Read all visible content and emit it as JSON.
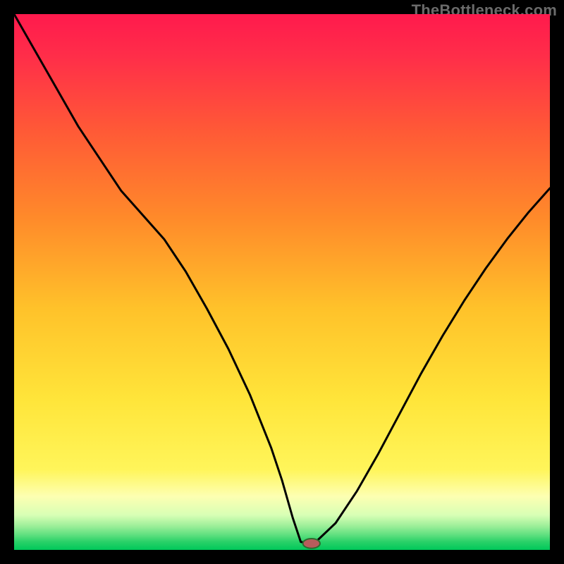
{
  "watermark": "TheBottleneck.com",
  "colors": {
    "black": "#000000",
    "curve": "#000000",
    "marker_fill": "#b85c5c",
    "marker_stroke": "#2f6a2f",
    "gradient_stops": [
      {
        "offset": 0.0,
        "color": "#ff1a4d"
      },
      {
        "offset": 0.08,
        "color": "#ff2e49"
      },
      {
        "offset": 0.22,
        "color": "#ff5a36"
      },
      {
        "offset": 0.38,
        "color": "#ff8a2a"
      },
      {
        "offset": 0.55,
        "color": "#ffc22a"
      },
      {
        "offset": 0.72,
        "color": "#ffe53a"
      },
      {
        "offset": 0.85,
        "color": "#fff55a"
      },
      {
        "offset": 0.9,
        "color": "#fdffb2"
      },
      {
        "offset": 0.935,
        "color": "#d8ffb5"
      },
      {
        "offset": 0.955,
        "color": "#9eef9a"
      },
      {
        "offset": 0.972,
        "color": "#5fe07f"
      },
      {
        "offset": 0.985,
        "color": "#29d168"
      },
      {
        "offset": 1.0,
        "color": "#00c85a"
      }
    ]
  },
  "chart_data": {
    "type": "line",
    "title": "",
    "xlabel": "",
    "ylabel": "",
    "xlim": [
      0,
      100
    ],
    "ylim": [
      0,
      100
    ],
    "series": [
      {
        "name": "bottleneck-curve",
        "x": [
          0,
          4,
          8,
          12,
          16,
          20,
          24,
          28,
          32,
          36,
          40,
          44,
          48,
          50,
          52,
          53.5,
          55,
          56,
          60,
          64,
          68,
          72,
          76,
          80,
          84,
          88,
          92,
          96,
          100
        ],
        "y": [
          100,
          93,
          86,
          79,
          73,
          67,
          62.5,
          58,
          52,
          45,
          37.5,
          29,
          19,
          13,
          6,
          1.5,
          1.2,
          1.2,
          5,
          11,
          18,
          25.5,
          33,
          40,
          46.5,
          52.5,
          58,
          63,
          67.5
        ]
      }
    ],
    "marker": {
      "x": 55.5,
      "y": 1.2,
      "rx": 1.6,
      "ry": 0.9
    }
  }
}
